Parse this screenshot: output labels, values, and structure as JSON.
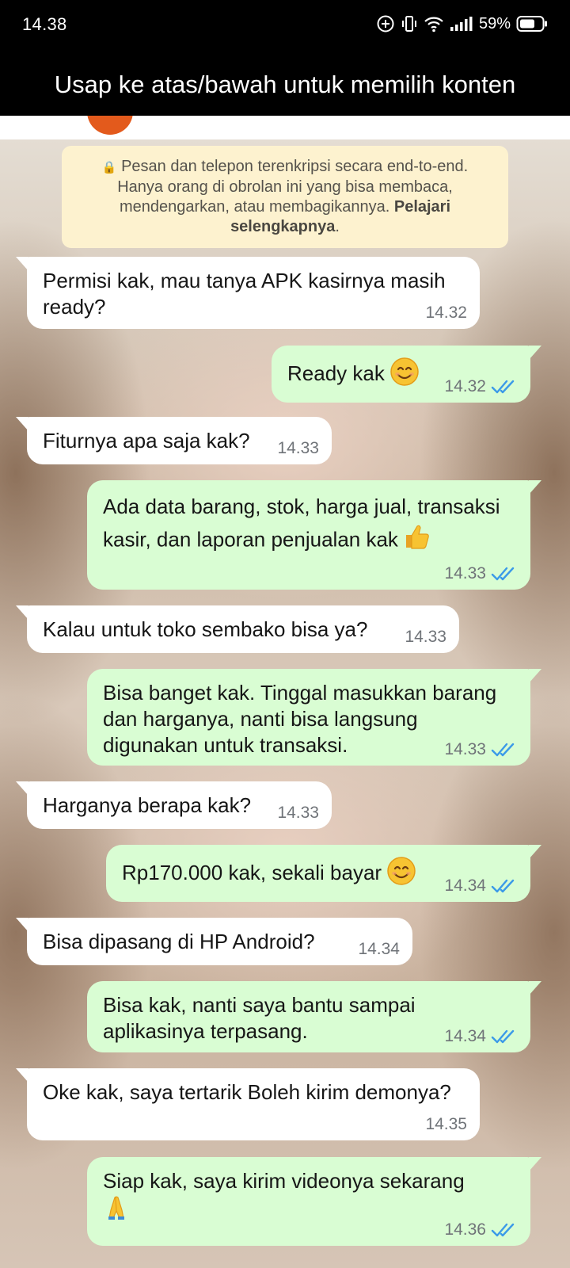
{
  "status_bar": {
    "time": "14.38",
    "battery": "59%"
  },
  "hint": "Usap ke atas/bawah untuk memilih konten",
  "notice": {
    "text": "Pesan dan telepon terenkripsi secara end-to-end. Hanya orang di obrolan ini yang bisa membaca, mendengarkan, atau membagikannya.",
    "link": "Pelajari selengkapnya",
    "suffix": "."
  },
  "messages": [
    {
      "dir": "in",
      "text": "Permisi kak, mau tanya APK kasirnya masih ready?",
      "time": "14.32"
    },
    {
      "dir": "out",
      "text": "Ready kak",
      "emoji": "smile",
      "time": "14.32",
      "status": "read"
    },
    {
      "dir": "in",
      "text": "Fiturnya apa saja kak?",
      "time": "14.33"
    },
    {
      "dir": "out",
      "text": "Ada data barang, stok, harga jual, transaksi kasir, dan laporan penjualan kak",
      "emoji": "thumbs-up",
      "time": "14.33",
      "status": "read"
    },
    {
      "dir": "in",
      "text": "Kalau untuk toko sembako bisa ya?",
      "time": "14.33"
    },
    {
      "dir": "out",
      "text": "Bisa banget kak. Tinggal masukkan barang dan harganya, nanti bisa langsung digunakan untuk transaksi.",
      "time": "14.33",
      "status": "read"
    },
    {
      "dir": "in",
      "text": "Harganya berapa kak?",
      "time": "14.33"
    },
    {
      "dir": "out",
      "text": "Rp170.000 kak, sekali bayar",
      "emoji": "smile",
      "time": "14.34",
      "status": "read"
    },
    {
      "dir": "in",
      "text": "Bisa dipasang di HP Android?",
      "time": "14.34"
    },
    {
      "dir": "out",
      "text": "Bisa kak, nanti saya bantu sampai aplikasinya terpasang.",
      "time": "14.34",
      "status": "read"
    },
    {
      "dir": "in",
      "text": "Oke kak, saya tertarik Boleh kirim demonya?",
      "time": "14.35"
    },
    {
      "dir": "out",
      "text": "Siap kak, saya kirim videonya sekarang",
      "emoji": "folded-hands",
      "time": "14.36",
      "status": "read"
    }
  ],
  "colors": {
    "incoming_bubble": "#ffffff",
    "outgoing_bubble": "#d9fdd3",
    "read_ticks": "#3b9ae8",
    "notice_bg": "#fdf2cf"
  }
}
